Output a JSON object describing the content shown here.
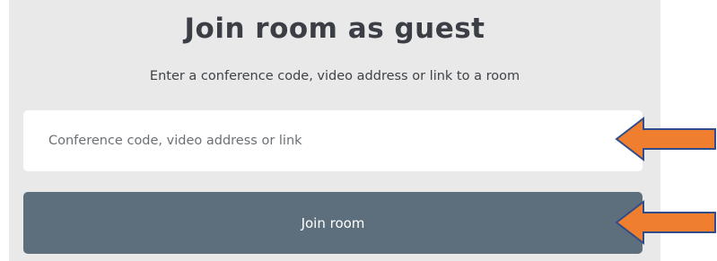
{
  "join_panel": {
    "title": "Join room as guest",
    "subtitle": "Enter a conference code, video address or link to a room",
    "input_placeholder": "Conference code, video address or link",
    "input_value": "",
    "join_button_label": "Join room"
  },
  "colors": {
    "panel_background": "#e9e9e9",
    "button_background": "#5d6f7d",
    "arrow_fill": "#ef7f2f",
    "arrow_stroke": "#2f4d8b"
  },
  "annotations": {
    "arrow_icon": "left-arrow-icon"
  }
}
